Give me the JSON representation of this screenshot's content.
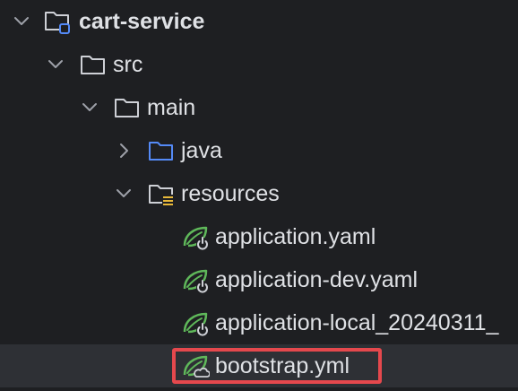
{
  "project_tree": {
    "items": [
      {
        "label": "cart-service",
        "icon": "module-folder-icon",
        "expanded": true
      },
      {
        "label": "src",
        "icon": "folder-icon",
        "expanded": true
      },
      {
        "label": "main",
        "icon": "folder-icon",
        "expanded": true
      },
      {
        "label": "java",
        "icon": "source-folder-icon",
        "expanded": false
      },
      {
        "label": "resources",
        "icon": "resources-folder-icon",
        "expanded": true
      },
      {
        "label": "application.yaml",
        "icon": "spring-config-icon"
      },
      {
        "label": "application-dev.yaml",
        "icon": "spring-config-icon"
      },
      {
        "label": "application-local_20240311_",
        "icon": "spring-config-icon"
      },
      {
        "label": "bootstrap.yml",
        "icon": "spring-cloud-config-icon",
        "selected": true,
        "highlighted": true
      }
    ]
  },
  "colors": {
    "background": "#1e1f22",
    "selected_row": "#2e3035",
    "highlight_border": "#e5484d",
    "spring_green": "#5fb85a",
    "source_folder_blue": "#548af7"
  }
}
